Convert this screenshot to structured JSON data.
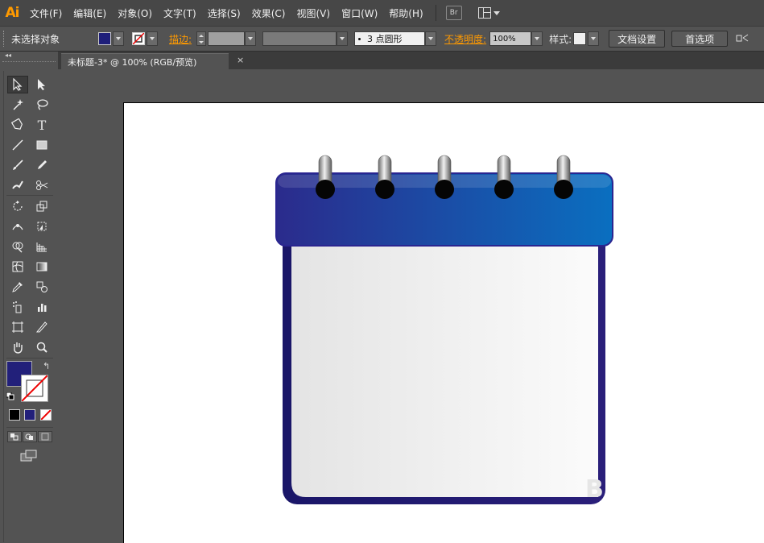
{
  "app": {
    "logo": "Ai"
  },
  "menubar": {
    "items": [
      "文件(F)",
      "编辑(E)",
      "对象(O)",
      "文字(T)",
      "选择(S)",
      "效果(C)",
      "视图(V)",
      "窗口(W)",
      "帮助(H)"
    ],
    "bridge_label": "Br"
  },
  "controlbar": {
    "selection_label": "未选择对象",
    "fill_color": "#1f1f7a",
    "stroke_label": "描边:",
    "brush_label": "3 点圆形",
    "opacity_label": "不透明度:",
    "opacity_value": "100%",
    "style_label": "样式:",
    "doc_setup_button": "文档设置",
    "prefs_button": "首选项"
  },
  "document_tab": {
    "title": "未标题-3* @ 100% (RGB/预览)",
    "close": "×"
  },
  "toolbox": {
    "fill_color": "#22207a"
  },
  "artwork": {
    "calendar_header_gradient": [
      "#2b2b8c",
      "#0a6fc0"
    ],
    "calendar_border": "#2a1f7a",
    "ring_count": 5
  },
  "watermark": "B"
}
